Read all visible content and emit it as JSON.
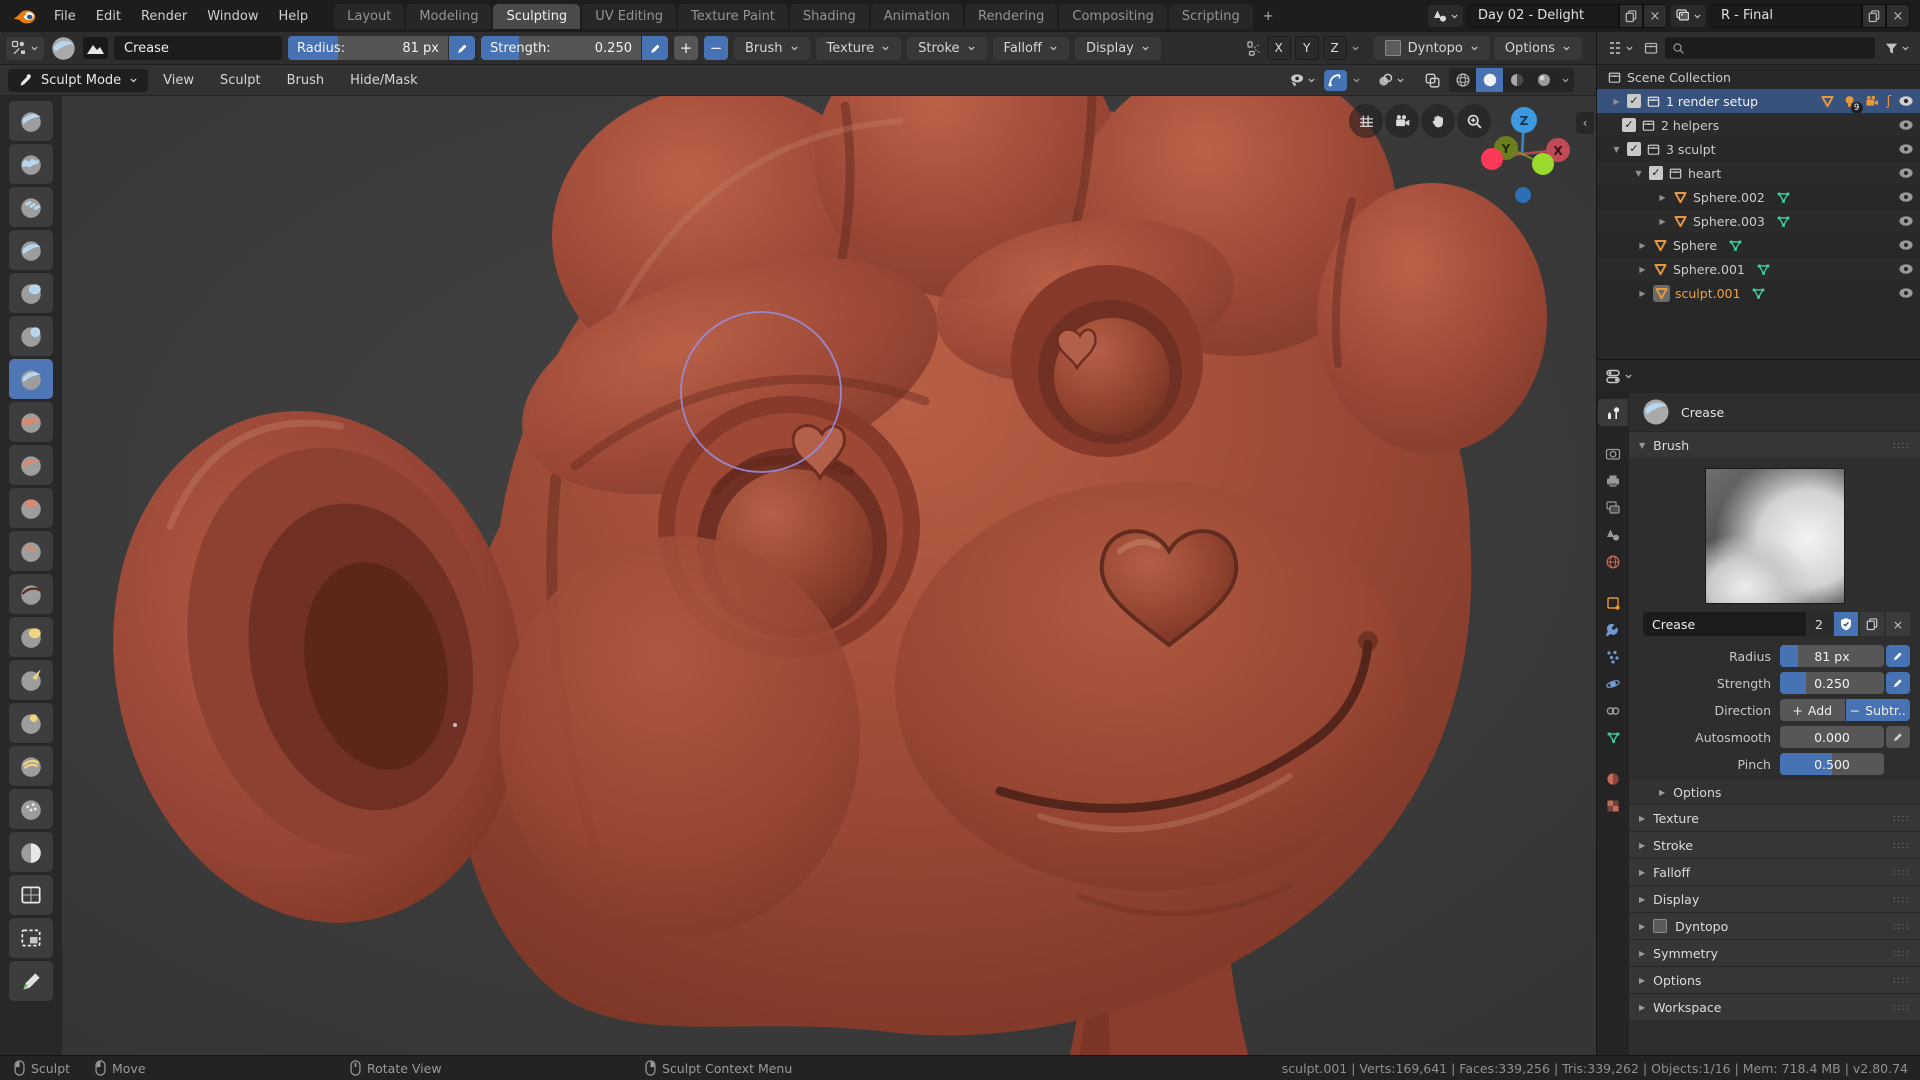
{
  "colors": {
    "accent_blue": "#4772b3",
    "selected_row_blue": "#38527e",
    "icon_orange": "#e8973c",
    "icon_green": "#3fd2a4",
    "active_object_text": "#eda145",
    "clay_base": "#9a4733",
    "viewport_bg": "#3c3c3c",
    "brush_cursor_purple": "#9a8cdd"
  },
  "topbar": {
    "menus": [
      "File",
      "Edit",
      "Render",
      "Window",
      "Help"
    ],
    "tabs": [
      "Layout",
      "Modeling",
      "Sculpting",
      "UV Editing",
      "Texture Paint",
      "Shading",
      "Animation",
      "Rendering",
      "Compositing",
      "Scripting",
      "+"
    ],
    "active_tab": "Sculpting",
    "scene_name": "Day 02 - Delight",
    "view_layer_name": "R - Final"
  },
  "tool_header": {
    "brush_name": "Crease",
    "radius_label": "Radius:",
    "radius_value": "81 px",
    "strength_label": "Strength:",
    "strength_value": "0.250",
    "add_label": "+",
    "subtract_label": "−",
    "popovers": [
      "Brush",
      "Texture",
      "Stroke",
      "Falloff",
      "Display"
    ],
    "axis_toggles": [
      "X",
      "Y",
      "Z"
    ],
    "dyntopo_label": "Dyntopo",
    "options_label": "Options"
  },
  "viewport_header": {
    "mode_label": "Sculpt Mode",
    "menus": [
      "View",
      "Sculpt",
      "Brush",
      "Hide/Mask"
    ]
  },
  "toolbar": {
    "active_brush": "crease",
    "brush_icons": [
      "draw",
      "clay",
      "clay-strips",
      "layer",
      "inflate",
      "blob",
      "crease",
      "smooth",
      "flatten",
      "fill",
      "scrape",
      "pinch",
      "grab",
      "snake-hook",
      "thumb",
      "rotate",
      "simplify",
      "mask",
      "box-mask",
      "box-hide",
      "annotate"
    ]
  },
  "viewport_overlay": {
    "nav_buttons": [
      "grid",
      "camera",
      "pan",
      "zoom"
    ],
    "gizmo_axes": {
      "z": "Z",
      "y": "Y",
      "x": "X"
    }
  },
  "outliner": {
    "scene_collection_label": "Scene Collection",
    "badge_count": "9",
    "rows": [
      {
        "label": "1 render setup"
      },
      {
        "label": "2 helpers"
      },
      {
        "label": "3 sculpt"
      },
      {
        "label": "heart"
      },
      {
        "label": "Sphere.002"
      },
      {
        "label": "Sphere.003"
      },
      {
        "label": "Sphere"
      },
      {
        "label": "Sphere.001"
      },
      {
        "label": "sculpt.001"
      }
    ],
    "selected_row": "1 render setup",
    "active_object": "sculpt.001"
  },
  "properties": {
    "title": "Crease",
    "brush_panel_label": "Brush",
    "name_field": "Crease",
    "users_count": "2",
    "fields": {
      "radius_label": "Radius",
      "radius_value": "81 px",
      "strength_label": "Strength",
      "strength_value": "0.250",
      "direction_label": "Direction",
      "direction_plus": "+",
      "direction_add": "Add",
      "direction_minus": "−",
      "direction_subtract": "Subtr..",
      "autosmooth_label": "Autosmooth",
      "autosmooth_value": "0.000",
      "pinch_label": "Pinch",
      "pinch_value": "0.500"
    },
    "sections": [
      "Options",
      "Texture",
      "Stroke",
      "Falloff",
      "Display",
      "Dyntopo",
      "Symmetry",
      "Options",
      "Workspace"
    ],
    "tab_icons": [
      "active-tool",
      "render",
      "output",
      "view-layer",
      "scene",
      "world",
      "object",
      "modifiers",
      "particles",
      "physics",
      "constraints",
      "object-data",
      "material",
      "texture"
    ]
  },
  "statusbar": {
    "hints": [
      {
        "label": "Sculpt"
      },
      {
        "label": "Move"
      },
      {
        "label": "Rotate View"
      },
      {
        "label": "Sculpt Context Menu"
      }
    ],
    "info": "sculpt.001 | Verts:169,641 | Faces:339,256 | Tris:339,262 | Objects:1/16 | Mem: 718.4 MB | v2.80.74"
  }
}
